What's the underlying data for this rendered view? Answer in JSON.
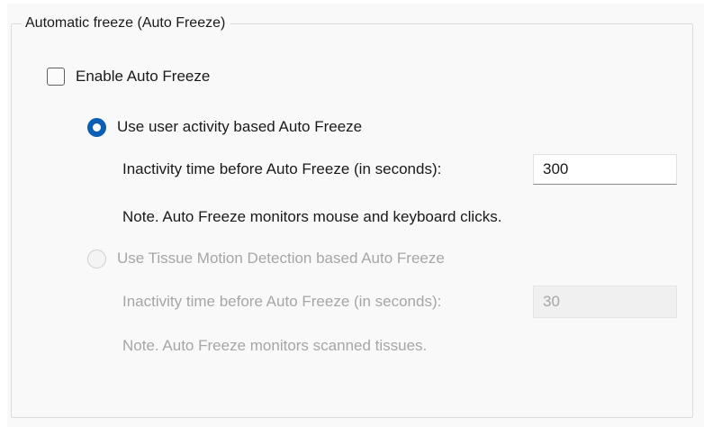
{
  "group": {
    "title": "Automatic freeze (Auto Freeze)"
  },
  "enable_checkbox": {
    "label": "Enable Auto Freeze",
    "checked": false
  },
  "user_activity_option": {
    "label": "Use user activity based Auto Freeze",
    "selected": true,
    "inactivity_label": "Inactivity time before Auto Freeze (in seconds):",
    "inactivity_value": "300",
    "note": "Note. Auto Freeze monitors mouse and keyboard clicks."
  },
  "tissue_motion_option": {
    "label": "Use Tissue Motion Detection based Auto Freeze",
    "selected": false,
    "disabled": true,
    "inactivity_label": "Inactivity time before Auto Freeze (in seconds):",
    "inactivity_value": "30",
    "note": "Note. Auto Freeze monitors scanned tissues."
  },
  "colors": {
    "accent": "#0a5fb4",
    "disabled_text": "#a6a6a6",
    "panel_background": "#f9f9f9"
  }
}
